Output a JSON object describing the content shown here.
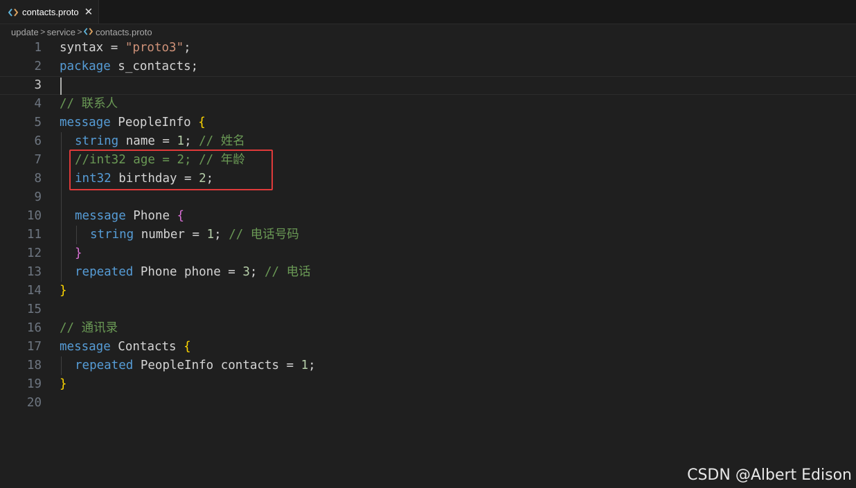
{
  "tab": {
    "label": "contacts.proto",
    "close": "✕",
    "icon": "proto-file-icon"
  },
  "breadcrumb": {
    "items": [
      "update",
      "service",
      "contacts.proto"
    ],
    "separator": ">"
  },
  "editor": {
    "current_line": 3,
    "lines": [
      {
        "n": "1"
      },
      {
        "n": "2"
      },
      {
        "n": "3"
      },
      {
        "n": "4"
      },
      {
        "n": "5"
      },
      {
        "n": "6"
      },
      {
        "n": "7"
      },
      {
        "n": "8"
      },
      {
        "n": "9"
      },
      {
        "n": "10"
      },
      {
        "n": "11"
      },
      {
        "n": "12"
      },
      {
        "n": "13"
      },
      {
        "n": "14"
      },
      {
        "n": "15"
      },
      {
        "n": "16"
      },
      {
        "n": "17"
      },
      {
        "n": "18"
      },
      {
        "n": "19"
      },
      {
        "n": "20"
      }
    ],
    "tokens": {
      "l1": {
        "a": "syntax = ",
        "b": "\"proto3\"",
        "c": ";"
      },
      "l2": {
        "a": "package",
        "b": " s_contacts;"
      },
      "l4": {
        "a": "// 联系人"
      },
      "l5": {
        "a": "message",
        "b": " PeopleInfo ",
        "c": "{"
      },
      "l6": {
        "a": "string",
        "b": " name = ",
        "c": "1",
        "d": "; ",
        "e": "// 姓名"
      },
      "l7": {
        "a": "//int32 age = 2; // 年龄"
      },
      "l8": {
        "a": "int32",
        "b": " birthday = ",
        "c": "2",
        "d": ";"
      },
      "l10": {
        "a": "message",
        "b": " Phone ",
        "c": "{"
      },
      "l11": {
        "a": "string",
        "b": " number = ",
        "c": "1",
        "d": "; ",
        "e": "// 电话号码"
      },
      "l12": {
        "a": "}"
      },
      "l13": {
        "a": "repeated",
        "b": " Phone phone = ",
        "c": "3",
        "d": "; ",
        "e": "// 电话"
      },
      "l14": {
        "a": "}"
      },
      "l16": {
        "a": "// 通讯录"
      },
      "l17": {
        "a": "message",
        "b": " Contacts ",
        "c": "{"
      },
      "l18": {
        "a": "repeated",
        "b": " PeopleInfo contacts = ",
        "c": "1",
        "d": ";"
      },
      "l19": {
        "a": "}"
      }
    }
  },
  "watermark": "CSDN @Albert Edison",
  "colors": {
    "background": "#1f1f1f",
    "keyword": "#569cd6",
    "string": "#ce9178",
    "number": "#b5cea8",
    "comment": "#6a9955",
    "bracket_outer": "#ffd700",
    "bracket_inner": "#da70d6",
    "highlight_box": "#e03a3a"
  }
}
